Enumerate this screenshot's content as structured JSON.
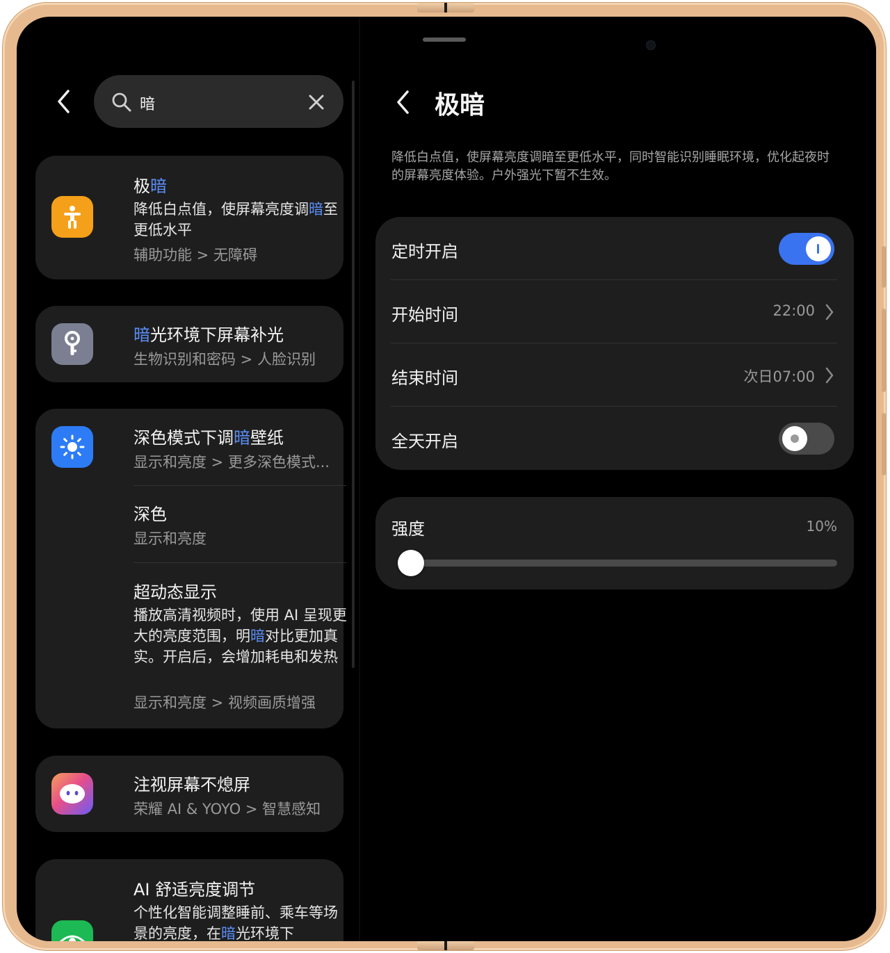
{
  "search": {
    "query": "暗"
  },
  "results": [
    {
      "title_pre": "极",
      "title_hl": "暗",
      "title_post": "",
      "desc_pre": "降低白点值，使屏幕亮度调",
      "desc_hl": "暗",
      "desc_post": "至更低水平",
      "path": "辅助功能 > 无障碍",
      "icon": "accessibility-icon",
      "icon_color": "#F5A01A"
    },
    {
      "title_pre": "",
      "title_hl": "暗",
      "title_post": "光环境下屏幕补光",
      "path": "生物识别和密码 > 人脸识别",
      "icon": "key-icon",
      "icon_color": "#7B7F91"
    },
    {
      "title_pre": "深色模式下调",
      "title_hl": "暗",
      "title_post": "壁纸",
      "path": "显示和亮度 > 更多深色模式...",
      "icon": "brightness-icon",
      "icon_color": "#2D7CF6"
    },
    {
      "title": "深色",
      "path": "显示和亮度"
    },
    {
      "title": "超动态显示",
      "desc_pre": "播放高清视频时，使用 AI 呈现更大的亮度范围，明",
      "desc_hl": "暗",
      "desc_post": "对比更加真实。开启后，会增加耗电和发热",
      "path": "显示和亮度 > 视频画质增强"
    },
    {
      "title": "注视屏幕不熄屏",
      "path": "荣耀 AI & YOYO > 智慧感知",
      "icon": "yoyo-assistant-icon"
    },
    {
      "title": "AI 舒适亮度调节",
      "desc_pre": "个性化智能调整睡前、乘车等场景的亮度，在",
      "desc_hl": "暗",
      "desc_post": "光环境下",
      "icon": "eye-comfort-icon",
      "icon_color": "#1DB954"
    }
  ],
  "detail": {
    "title": "极暗",
    "description": "降低白点值，使屏幕亮度调暗至更低水平，同时智能识别睡眠环境，优化起夜时的屏幕亮度体验。户外强光下暂不生效。",
    "schedule": {
      "timed_on_label": "定时开启",
      "timed_on": true,
      "start_label": "开始时间",
      "start_value": "22:00",
      "end_label": "结束时间",
      "end_value": "次日07:00",
      "all_day_label": "全天开启",
      "all_day": false
    },
    "intensity": {
      "label": "强度",
      "value_text": "10%",
      "value": 0.1
    }
  },
  "colors": {
    "accent": "#3A73F0",
    "highlight": "#5B8FF9",
    "card_bg": "#1E1E1E",
    "frame": "#E6B98F"
  }
}
